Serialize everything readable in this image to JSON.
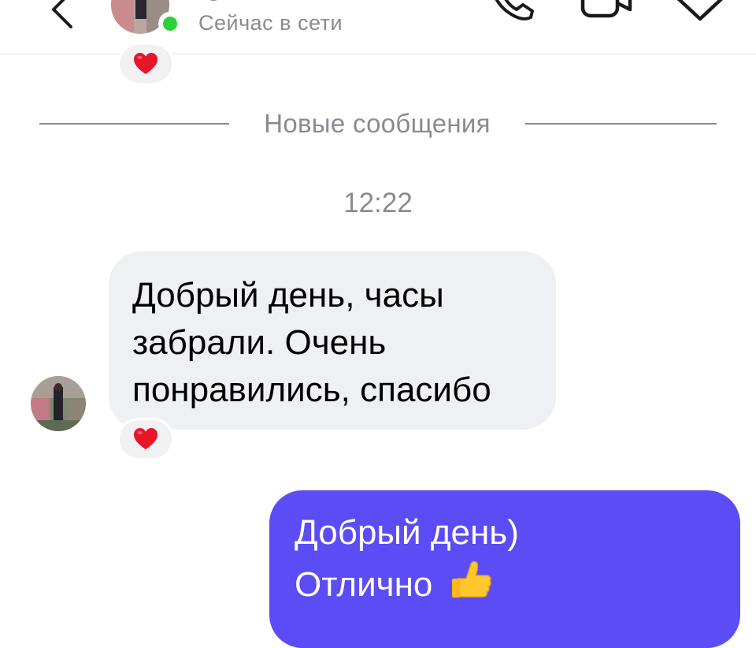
{
  "header": {
    "status": "Сейчас в сети",
    "online_color": "#2bd13a",
    "icons": [
      "back-arrow-icon",
      "avatar",
      "phone-icon",
      "video-camera-icon",
      "tag-icon"
    ]
  },
  "chat": {
    "separator_label": "Новые сообщения",
    "time": "12:22",
    "incoming": {
      "lines": [
        "Добрый день, часы",
        "забрали. Очень",
        "понравились, спасибо"
      ],
      "reaction": "heart-icon"
    },
    "outgoing": {
      "lines": [
        "Добрый день)",
        "Отлично"
      ],
      "emoji": "thumbs-up-icon",
      "bubble_color": "#5b4cf5"
    },
    "top_reaction": "heart-icon"
  }
}
